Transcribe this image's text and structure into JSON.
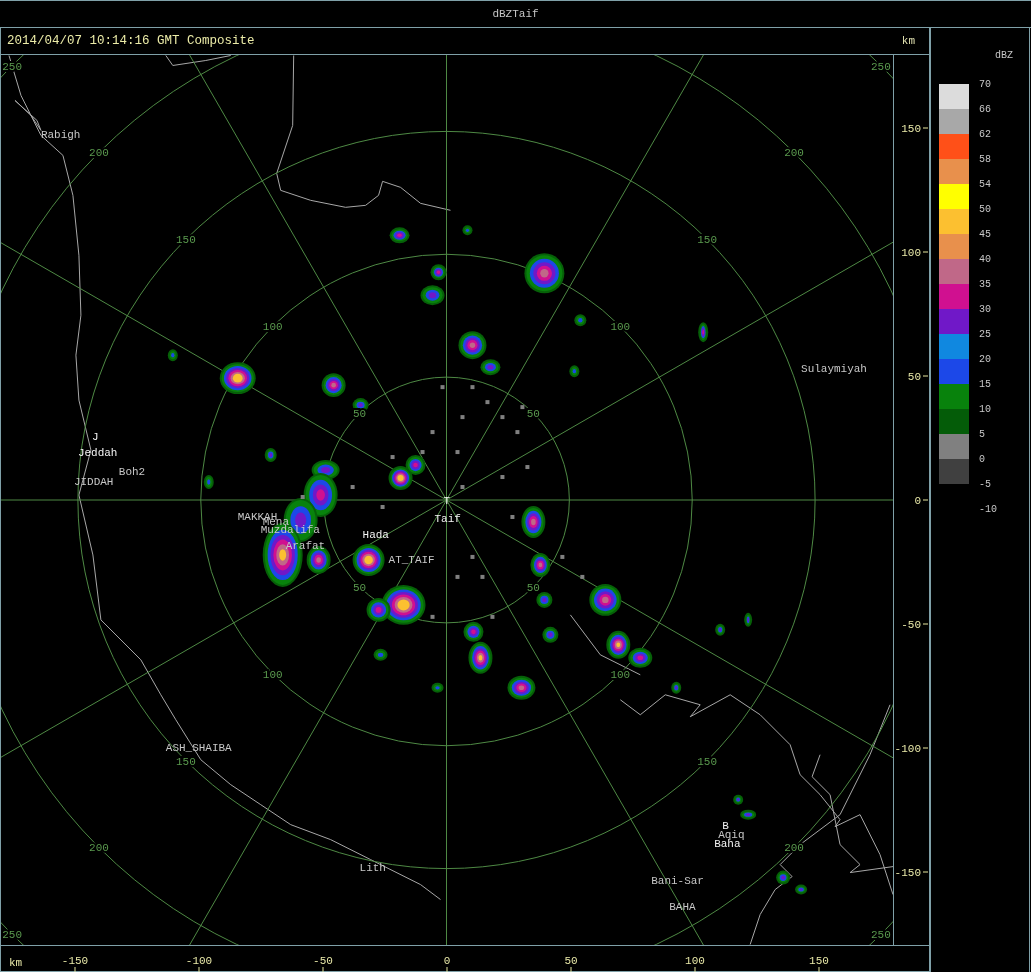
{
  "window": {
    "title": "dBZTaif"
  },
  "header": {
    "timestamp": "2014/04/07 10:14:16 GMT Composite",
    "unit": "km"
  },
  "range_rings": [
    {
      "labels": [
        "50",
        "50",
        "50",
        "50"
      ]
    },
    {
      "labels": [
        "100",
        "100",
        "100",
        "100"
      ]
    },
    {
      "labels": [
        "150",
        "150",
        "150",
        "150"
      ]
    },
    {
      "labels": [
        "200",
        "200",
        "200",
        "200"
      ]
    },
    {
      "labels": [
        "250",
        "250",
        "250",
        "250"
      ]
    }
  ],
  "places": [
    "Rabigh",
    "J",
    "Jeddah",
    "Boh2",
    "JIDDAH",
    "MAKKAH",
    "Mena",
    "Muzdalifa",
    "Arafat",
    "Hada",
    "AT_TAIF",
    "T",
    "Taif",
    "Sulaymiyah",
    "ASH_SHAIBA",
    "Lith",
    "B",
    "Aqiq",
    "Baha",
    "Bani-Sar",
    "BAHA"
  ],
  "y_axis": {
    "ticks": [
      "150",
      "100",
      "50",
      "0",
      "-50",
      "-100",
      "-150"
    ]
  },
  "x_axis": {
    "unit": "km",
    "ticks": [
      "-150",
      "-100",
      "-50",
      "0",
      "50",
      "100",
      "150"
    ]
  },
  "legend": {
    "title": "dBZ",
    "bins": [
      {
        "color": "#dcdcdc"
      },
      {
        "color": "#a8a8a8"
      },
      {
        "color": "#ff5018"
      },
      {
        "color": "#e8904c"
      },
      {
        "color": "#ffff00"
      },
      {
        "color": "#fcc030"
      },
      {
        "color": "#e8904c"
      },
      {
        "color": "#c06888"
      },
      {
        "color": "#d01090"
      },
      {
        "color": "#7018c8"
      },
      {
        "color": "#1088e0"
      },
      {
        "color": "#1c48e8"
      },
      {
        "color": "#08820c"
      },
      {
        "color": "#045c08"
      },
      {
        "color": "#808080"
      },
      {
        "color": "#404040"
      }
    ],
    "labels": [
      "70",
      "66",
      "62",
      "58",
      "54",
      "50",
      "45",
      "40",
      "35",
      "30",
      "25",
      "20",
      "15",
      "10",
      "5",
      "0",
      "-5",
      "-10"
    ]
  }
}
